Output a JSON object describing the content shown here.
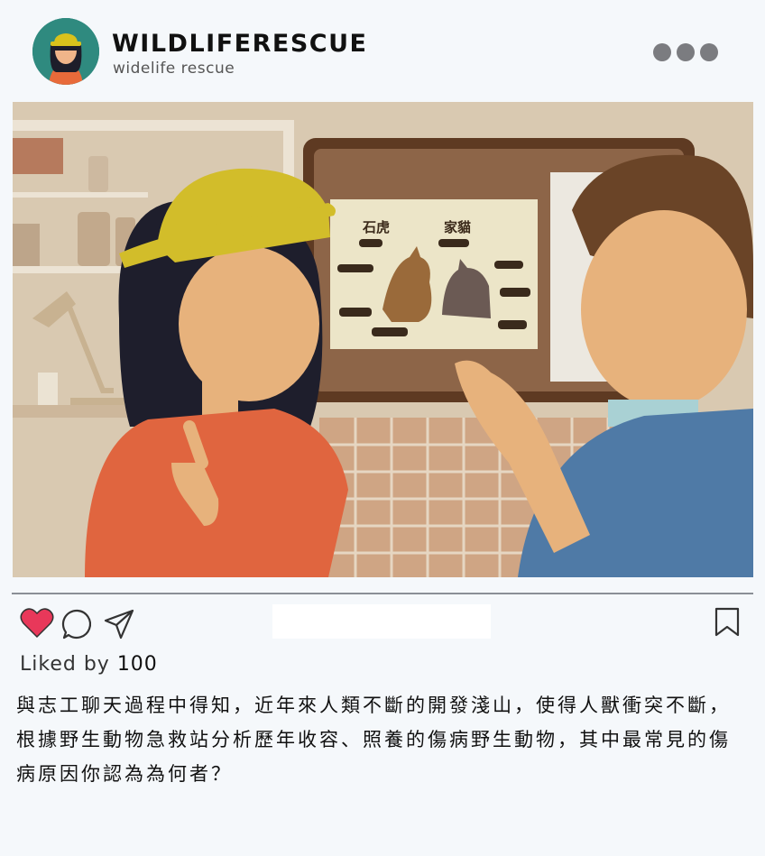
{
  "post": {
    "account_name": "WILDLIFERESCUE",
    "account_subtitle": "widelife rescue",
    "liked_by_prefix": "Liked by",
    "like_count": "100",
    "caption": "與志工聊天過程中得知，近年來人類不斷的開發淺山，使得人獸衝突不斷，根據野生動物急救站分析歷年收容、照養的傷病野生動物，其中最常見的傷病原因你認為為何者？",
    "image": {
      "board_labels": [
        "石虎",
        "家貓"
      ]
    }
  },
  "icons": {
    "more": "more-dots-icon",
    "like": "heart-icon",
    "comment": "comment-bubble-icon",
    "share": "paper-plane-icon",
    "save": "bookmark-icon"
  },
  "colors": {
    "heart": "#e8385a",
    "background": "#f5f8fb",
    "divider": "#8a8f96"
  }
}
